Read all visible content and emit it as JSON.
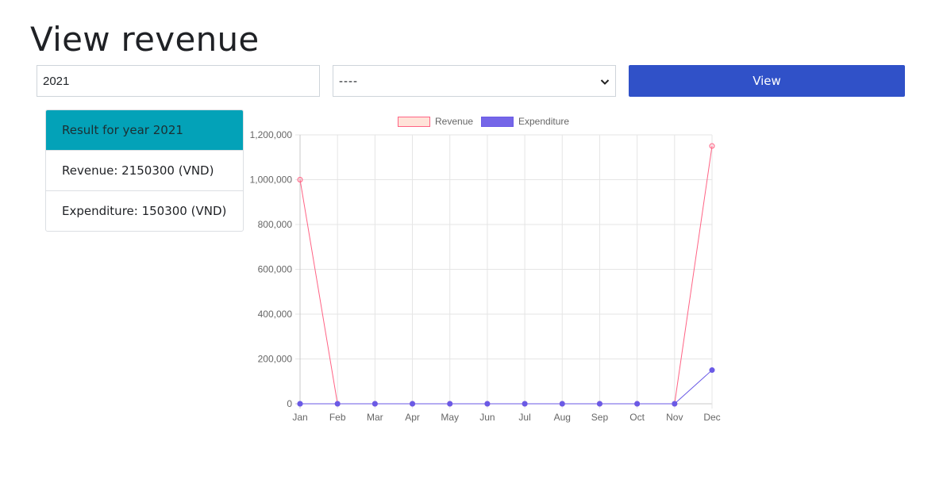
{
  "page": {
    "title": "View revenue"
  },
  "filters": {
    "year_value": "2021",
    "month_selected": "----",
    "view_label": "View"
  },
  "result": {
    "header": "Result for year 2021",
    "revenue_text": "Revenue: 2150300 (VND)",
    "expenditure_text": "Expenditure: 150300 (VND)"
  },
  "colors": {
    "button": "#3051c8",
    "result_header": "#03a2b8",
    "revenue_line": "#ff6384",
    "revenue_fill": "#ffe3d9",
    "expenditure_line": "#6a5ae6",
    "expenditure_fill": "#7566e8"
  },
  "chart_data": {
    "type": "line",
    "categories": [
      "Jan",
      "Feb",
      "Mar",
      "Apr",
      "May",
      "Jun",
      "Jul",
      "Aug",
      "Sep",
      "Oct",
      "Nov",
      "Dec"
    ],
    "series": [
      {
        "name": "Revenue",
        "values": [
          1000000,
          0,
          0,
          0,
          0,
          0,
          0,
          0,
          0,
          0,
          0,
          1150300
        ]
      },
      {
        "name": "Expenditure",
        "values": [
          0,
          0,
          0,
          0,
          0,
          0,
          0,
          0,
          0,
          0,
          0,
          150300
        ]
      }
    ],
    "ylim": [
      0,
      1200000
    ],
    "yticks": [
      "0",
      "200,000",
      "400,000",
      "600,000",
      "800,000",
      "1,000,000",
      "1,200,000"
    ],
    "grid": true,
    "legend": "top"
  }
}
